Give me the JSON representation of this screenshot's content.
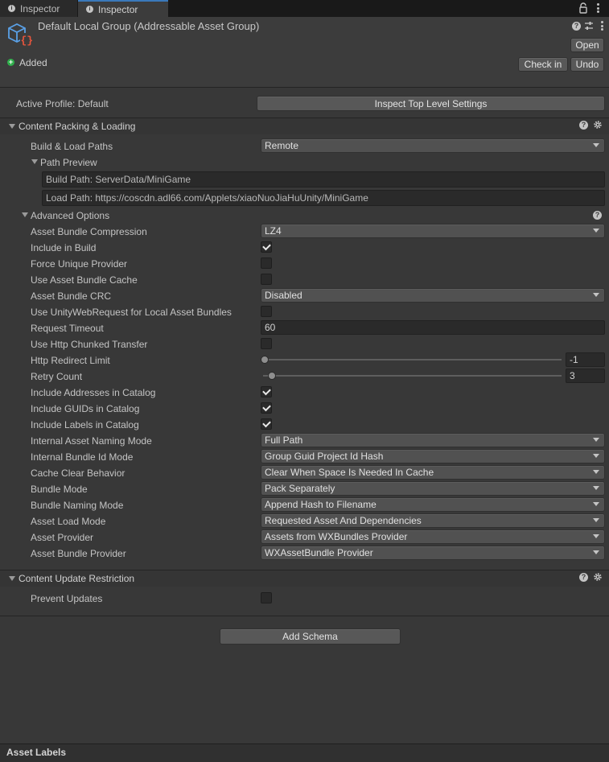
{
  "tabs": [
    {
      "label": "Inspector",
      "active": false
    },
    {
      "label": "Inspector",
      "active": true
    }
  ],
  "header": {
    "title": "Default Local Group (Addressable Asset Group)",
    "open_label": "Open",
    "status_label": "Added",
    "checkin_label": "Check in",
    "undo_label": "Undo"
  },
  "profile": {
    "label": "Active Profile: Default",
    "button_label": "Inspect Top Level Settings"
  },
  "content_packing": {
    "title": "Content Packing & Loading",
    "build_load_paths_label": "Build & Load Paths",
    "build_load_paths_value": "Remote",
    "path_preview_label": "Path Preview",
    "build_path": "Build Path: ServerData/MiniGame",
    "load_path": "Load Path: https://coscdn.adl66.com/Applets/xiaoNuoJiaHuUnity/MiniGame",
    "advanced_label": "Advanced Options"
  },
  "advanced": {
    "compression_label": "Asset Bundle Compression",
    "compression_value": "LZ4",
    "include_build_label": "Include in Build",
    "include_build": true,
    "force_unique_label": "Force Unique Provider",
    "force_unique": false,
    "use_cache_label": "Use Asset Bundle Cache",
    "use_cache": false,
    "crc_label": "Asset Bundle CRC",
    "crc_value": "Disabled",
    "uwr_local_label": "Use UnityWebRequest for Local Asset Bundles",
    "uwr_local": false,
    "timeout_label": "Request Timeout",
    "timeout_value": "60",
    "chunked_label": "Use Http Chunked Transfer",
    "chunked": false,
    "redirect_label": "Http Redirect Limit",
    "redirect_value": "-1",
    "retry_label": "Retry Count",
    "retry_value": "3",
    "include_addresses_label": "Include Addresses in Catalog",
    "include_addresses": true,
    "include_guids_label": "Include GUIDs in Catalog",
    "include_guids": true,
    "include_labels_label": "Include Labels in Catalog",
    "include_labels": true,
    "naming_mode_label": "Internal Asset Naming Mode",
    "naming_mode_value": "Full Path",
    "bundle_id_label": "Internal Bundle Id Mode",
    "bundle_id_value": "Group Guid Project Id Hash",
    "cache_clear_label": "Cache Clear Behavior",
    "cache_clear_value": "Clear When Space Is Needed In Cache",
    "bundle_mode_label": "Bundle Mode",
    "bundle_mode_value": "Pack Separately",
    "bundle_naming_label": "Bundle Naming Mode",
    "bundle_naming_value": "Append Hash to Filename",
    "load_mode_label": "Asset Load Mode",
    "load_mode_value": "Requested Asset And Dependencies",
    "provider_label": "Asset Provider",
    "provider_value": "Assets from WXBundles Provider",
    "bundle_provider_label": "Asset Bundle Provider",
    "bundle_provider_value": "WXAssetBundle Provider"
  },
  "content_update": {
    "title": "Content Update Restriction",
    "prevent_label": "Prevent Updates",
    "prevent": false
  },
  "add_schema_label": "Add Schema",
  "footer_label": "Asset Labels",
  "colors": {
    "background": "#383838",
    "accent": "#3a79bb",
    "added_status": "#2fae4b",
    "asset_icon_blue": "#5aa0e6",
    "asset_icon_red": "#e8553d"
  }
}
